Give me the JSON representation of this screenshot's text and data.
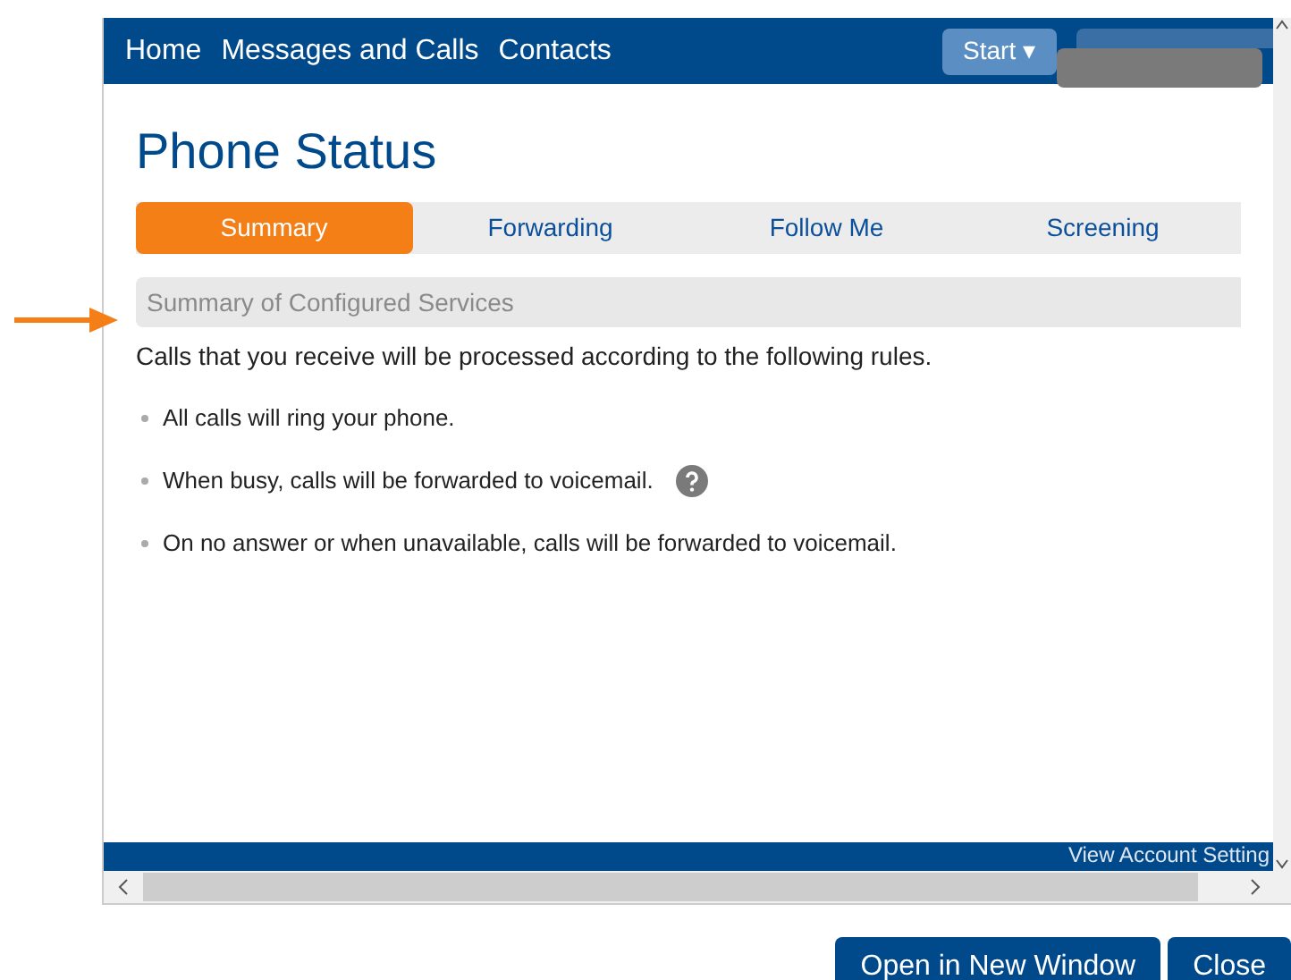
{
  "nav": {
    "links": [
      "Home",
      "Messages and Calls",
      "Contacts"
    ],
    "start_button": "Start ▾"
  },
  "page": {
    "title": "Phone Status",
    "tabs": [
      {
        "label": "Summary",
        "selected": true
      },
      {
        "label": "Forwarding",
        "selected": false
      },
      {
        "label": "Follow Me",
        "selected": false
      },
      {
        "label": "Screening",
        "selected": false
      }
    ],
    "section_header": "Summary of Configured Services",
    "intro": "Calls that you receive will be processed according to the following rules.",
    "rules": [
      {
        "text": "All calls will ring your phone.",
        "help": false
      },
      {
        "text": "When busy, calls will be forwarded to voicemail.",
        "help": true
      },
      {
        "text": "On no answer or when unavailable, calls will be forwarded to voicemail.",
        "help": false
      }
    ]
  },
  "footer": {
    "link": "View Account Setting"
  },
  "buttons": [
    "Open in New Window",
    "Close"
  ]
}
